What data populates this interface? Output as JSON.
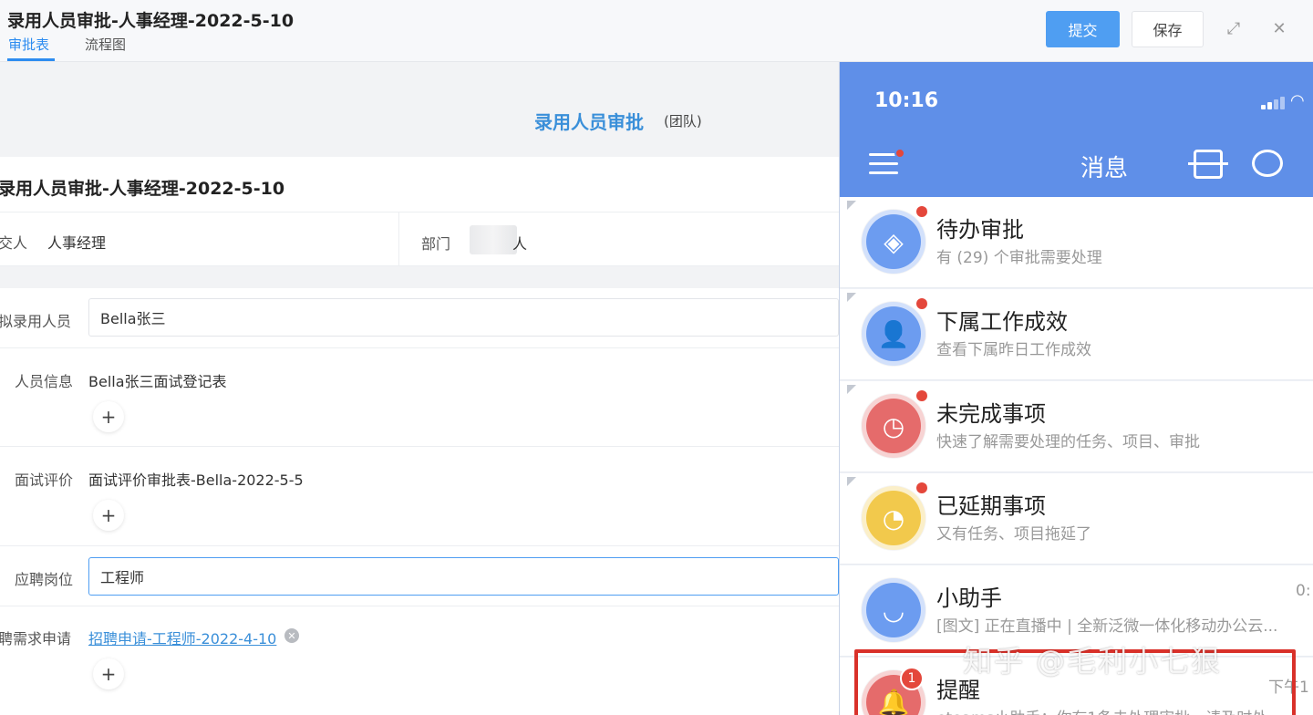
{
  "header": {
    "title": "录用人员审批-人事经理-2022-5-10",
    "tabs": [
      "审批表",
      "流程图"
    ],
    "submit_label": "提交",
    "save_label": "保存",
    "expand_icon": "⤢",
    "close_icon": "✕"
  },
  "form": {
    "heading": "录用人员审批",
    "heading_sub": "(团队)",
    "title": "录用人员审批-人事经理-2022-5-10",
    "submitter_label": "交人",
    "submitter_value": "人事经理",
    "dept_label": "部门",
    "dept_value": "人",
    "fields": {
      "candidate_label": "拟录用人员",
      "candidate_value": "Bella张三",
      "info_label": "人员信息",
      "info_value": "Bella张三面试登记表",
      "interview_label": "面试评价",
      "interview_value": "面试评价审批表-Bella-2022-5-5",
      "position_label": "应聘岗位",
      "position_value": "工程师",
      "request_label": "聘需求申请",
      "request_value": "招聘申请-工程师-2022-4-10"
    },
    "plus": "+"
  },
  "phone": {
    "time": "10:16",
    "nav_title": "消息",
    "messages": [
      {
        "title": "待办审批",
        "sub": "有 (29) 个审批需要处理",
        "color": "#6c9cf0",
        "icon": "◈"
      },
      {
        "title": "下属工作成效",
        "sub": "查看下属昨日工作成效",
        "color": "#6c9cf0",
        "icon": "👤"
      },
      {
        "title": "未完成事项",
        "sub": "快速了解需要处理的任务、项目、审批",
        "color": "#e56b6b",
        "icon": "◷"
      },
      {
        "title": "已延期事项",
        "sub": "又有任务、项目拖延了",
        "color": "#f2c94c",
        "icon": "◔"
      },
      {
        "title": "小助手",
        "sub": "[图文] 正在直播中 | 全新泛微一体化移动办公云...",
        "time": "0:",
        "color": "#6c9cf0",
        "icon": "◡"
      },
      {
        "title": "提醒",
        "sub": "eteams小助手：你有1条未处理审批，请及时处",
        "time": "下午1",
        "badge": "1",
        "color": "#e56b6b",
        "icon": "🔔"
      }
    ]
  },
  "watermark": "知乎 @毛利小七狠"
}
